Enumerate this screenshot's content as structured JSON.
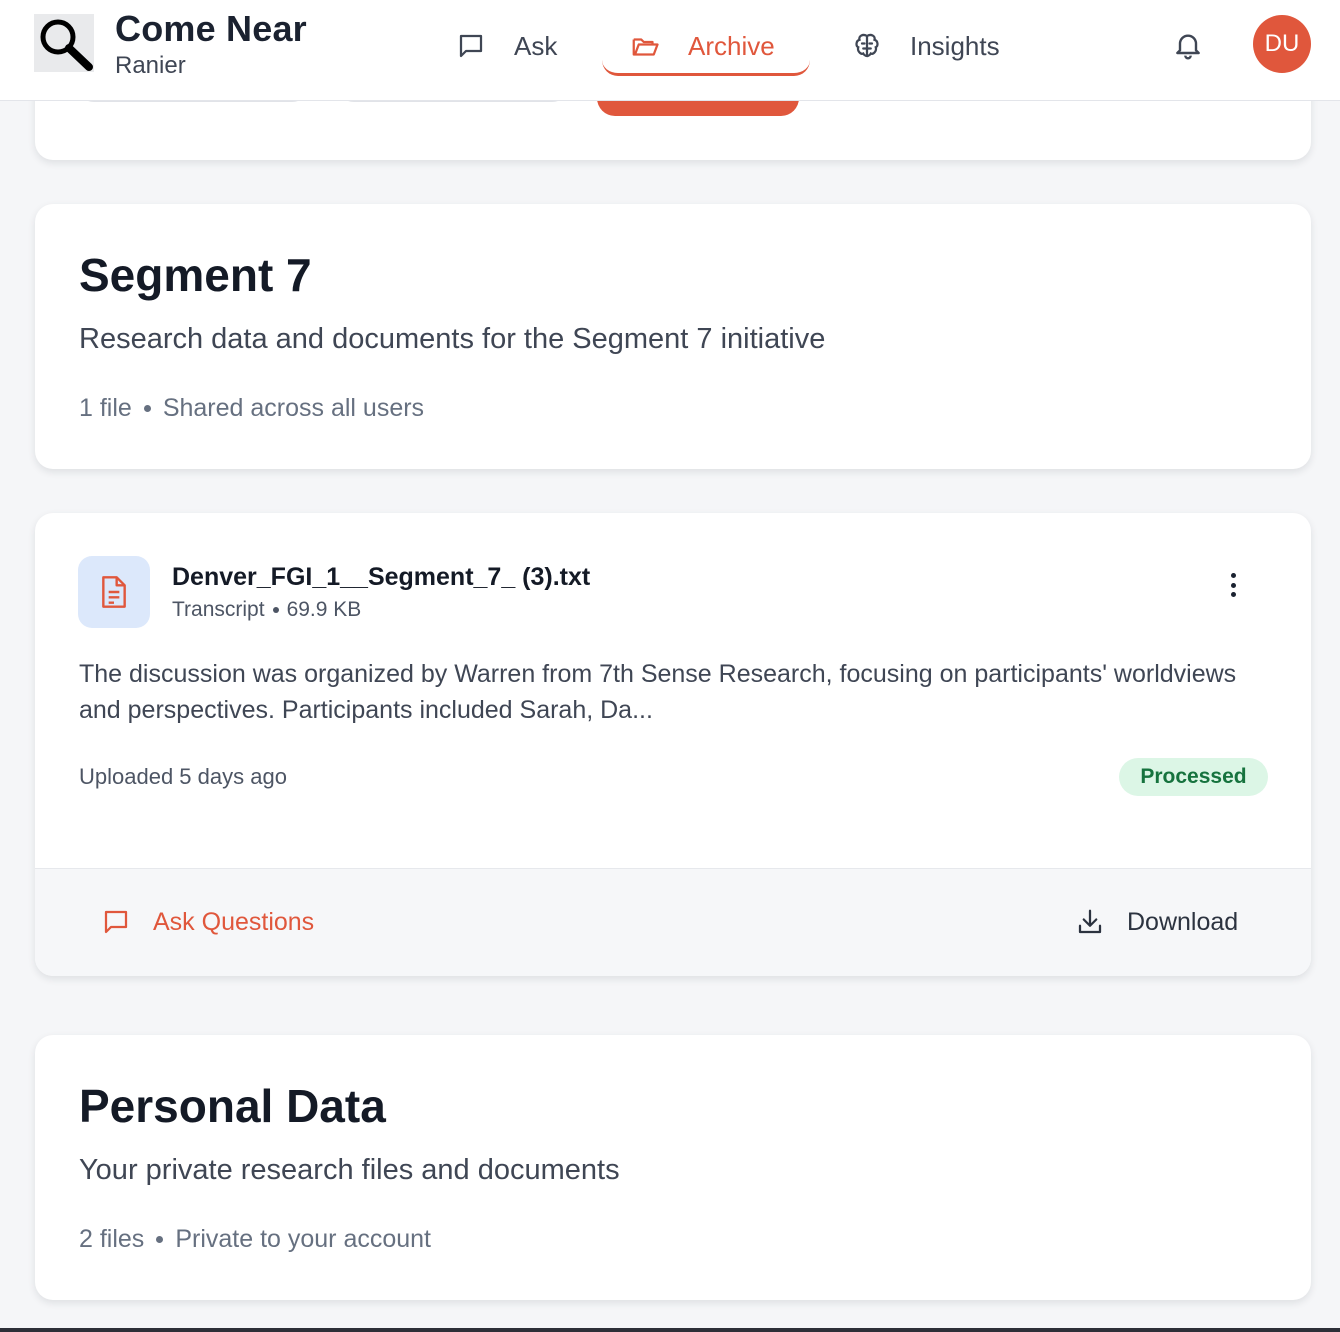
{
  "header": {
    "brand_title": "Come Near",
    "brand_subtitle": "Ranier",
    "nav": [
      {
        "label": "Ask",
        "icon": "chat-icon",
        "active": false
      },
      {
        "label": "Archive",
        "icon": "folder-icon",
        "active": true
      },
      {
        "label": "Insights",
        "icon": "brain-icon",
        "active": false
      }
    ],
    "avatar_initials": "DU"
  },
  "sections": [
    {
      "title": "Segment 7",
      "description": "Research data and documents for the Segment 7 initiative",
      "file_count": "1 file",
      "sharing": "Shared across all users",
      "files": [
        {
          "name": "Denver_FGI_1__Segment_7_ (3).txt",
          "type": "Transcript",
          "size": "69.9 KB",
          "summary": "The discussion was organized by Warren from 7th Sense Research, focusing on participants' worldviews and perspectives. Participants included Sarah, Da...",
          "uploaded": "Uploaded 5 days ago",
          "status": "Processed",
          "ask_label": "Ask Questions",
          "download_label": "Download"
        }
      ]
    },
    {
      "title": "Personal Data",
      "description": "Your private research files and documents",
      "file_count": "2 files",
      "sharing": "Private to your account"
    }
  ],
  "colors": {
    "accent": "#e0573c",
    "background": "#f5f6f8",
    "badge_bg": "#dcf6e6",
    "badge_text": "#16733e",
    "file_icon_bg": "#dce8fb"
  }
}
